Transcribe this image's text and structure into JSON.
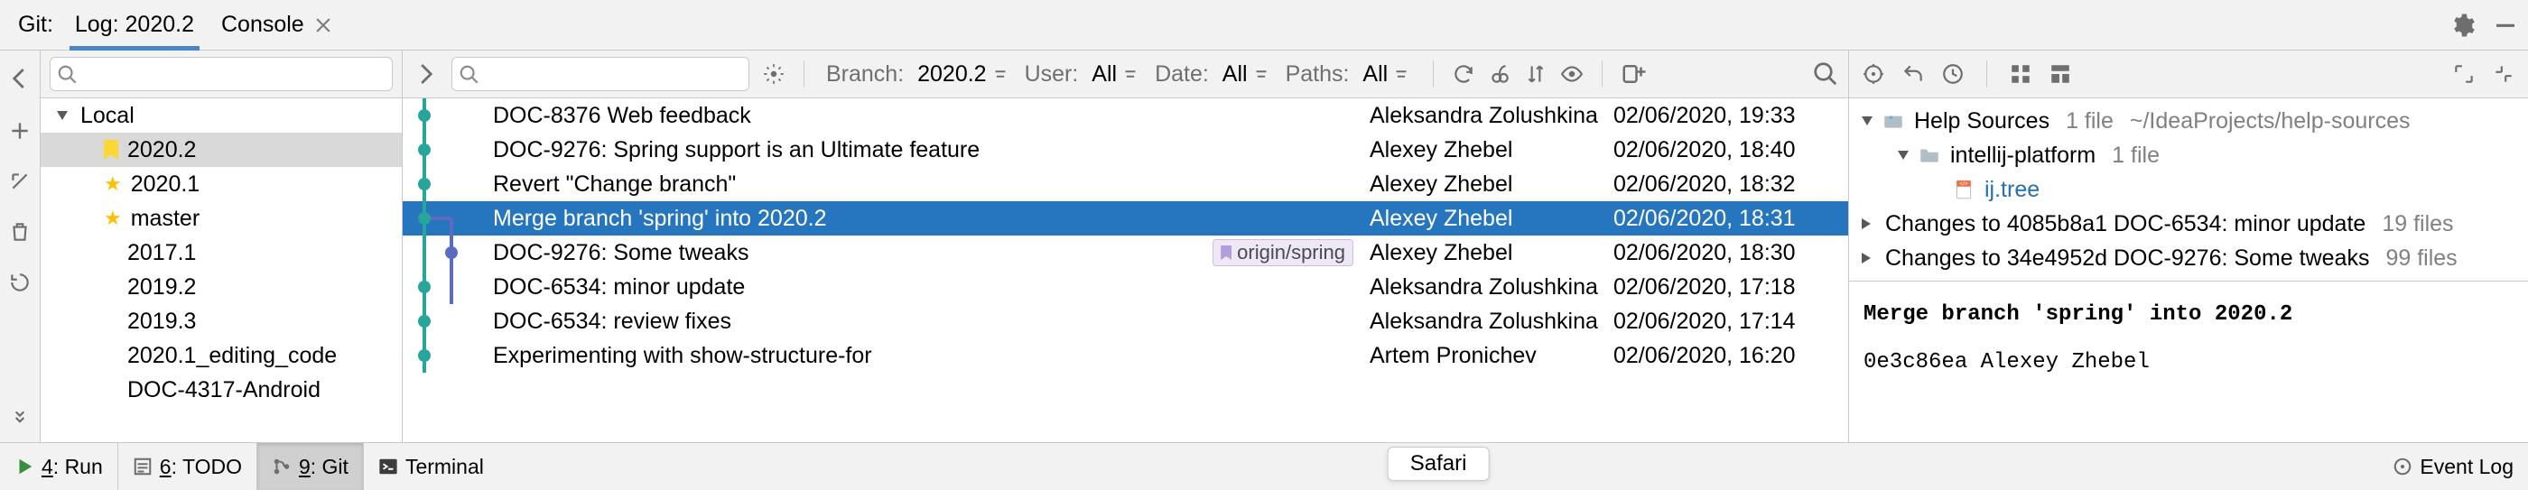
{
  "header": {
    "title": "Git:",
    "tabs": [
      {
        "label": "Log: 2020.2",
        "active": true,
        "closable": false
      },
      {
        "label": "Console",
        "active": false,
        "closable": true
      }
    ]
  },
  "branches": {
    "root": "Local",
    "items": [
      {
        "label": "2020.2",
        "sel": true,
        "icon": "bookmark"
      },
      {
        "label": "2020.1",
        "icon": "star"
      },
      {
        "label": "master",
        "icon": "star"
      },
      {
        "label": "2017.1"
      },
      {
        "label": "2019.2"
      },
      {
        "label": "2019.3"
      },
      {
        "label": "2020.1_editing_code"
      },
      {
        "label": "DOC-4317-Android"
      }
    ]
  },
  "filters": {
    "branch_label": "Branch:",
    "branch_value": "2020.2",
    "user_label": "User:",
    "user_value": "All",
    "date_label": "Date:",
    "date_value": "All",
    "paths_label": "Paths:",
    "paths_value": "All"
  },
  "commits": [
    {
      "msg": "DOC-8376 Web feedback",
      "author": "Aleksandra Zolushkina",
      "date": "02/06/2020, 19:33",
      "lane": 0
    },
    {
      "msg": "DOC-9276: Spring support is an Ultimate feature",
      "author": "Alexey Zhebel",
      "date": "02/06/2020, 18:40",
      "lane": 0
    },
    {
      "msg": "Revert \"Change branch\"",
      "author": "Alexey Zhebel",
      "date": "02/06/2020, 18:32",
      "lane": 0
    },
    {
      "msg": "Merge branch 'spring' into 2020.2",
      "author": "Alexey Zhebel",
      "date": "02/06/2020, 18:31",
      "lane": 0,
      "sel": true,
      "merge": true
    },
    {
      "msg": "DOC-9276: Some tweaks",
      "author": "Alexey Zhebel",
      "date": "02/06/2020, 18:30",
      "lane": 1,
      "ref": "origin/spring"
    },
    {
      "msg": "DOC-6534: minor update",
      "author": "Aleksandra Zolushkina",
      "date": "02/06/2020, 17:18",
      "lane": 0
    },
    {
      "msg": "DOC-6534: review fixes",
      "author": "Aleksandra Zolushkina",
      "date": "02/06/2020, 17:14",
      "lane": 0
    },
    {
      "msg": "Experimenting with show-structure-for",
      "author": "Artem Pronichev",
      "date": "02/06/2020, 16:20",
      "lane": 0
    }
  ],
  "details": {
    "root": {
      "label": "Help Sources",
      "count": "1 file",
      "path": "~/IdeaProjects/help-sources"
    },
    "child": {
      "label": "intellij-platform",
      "count": "1 file"
    },
    "file": "ij.tree",
    "changes": [
      {
        "label": "Changes to 4085b8a1 DOC-6534: minor update",
        "count": "19 files"
      },
      {
        "label": "Changes to 34e4952d DOC-9276: Some tweaks",
        "count": "99 files"
      }
    ],
    "msg_title": "Merge branch 'spring' into 2020.2",
    "msg_hash": "0e3c86ea",
    "msg_author": "Alexey Zhebel"
  },
  "status": {
    "run": "4: Run",
    "run_u": "4",
    "todo": "6: TODO",
    "todo_u": "6",
    "git": "9: Git",
    "git_u": "9",
    "terminal": "Terminal",
    "eventlog": "Event Log",
    "pill": "Safari"
  }
}
